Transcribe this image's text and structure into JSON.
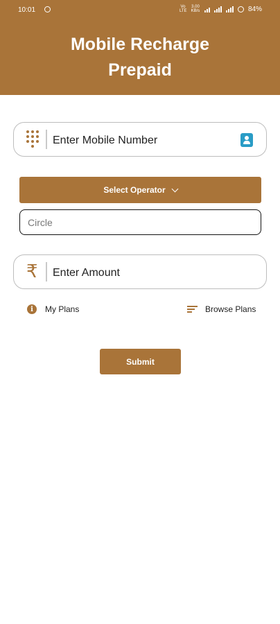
{
  "status_bar": {
    "time": "10:01",
    "vol_lte": "Vo LTE",
    "speed": "3.00 KB/s",
    "battery": "84%"
  },
  "header": {
    "title_line1": "Mobile Recharge",
    "title_line2": "Prepaid",
    "background": "#a97439"
  },
  "mobile": {
    "label": "Enter Mobile Number",
    "lead_icon": "dialpad-icon",
    "trail_icon": "contacts-icon"
  },
  "operator": {
    "label": "Select Operator"
  },
  "circle": {
    "placeholder": "Circle",
    "value": ""
  },
  "amount": {
    "label": "Enter Amount",
    "icon": "rupee-icon",
    "symbol": "₹"
  },
  "links": {
    "my_plans": "My Plans",
    "browse_plans": "Browse Plans"
  },
  "submit": {
    "label": "Submit"
  },
  "colors": {
    "accent": "#a97439",
    "contacts": "#2a9cc6"
  }
}
